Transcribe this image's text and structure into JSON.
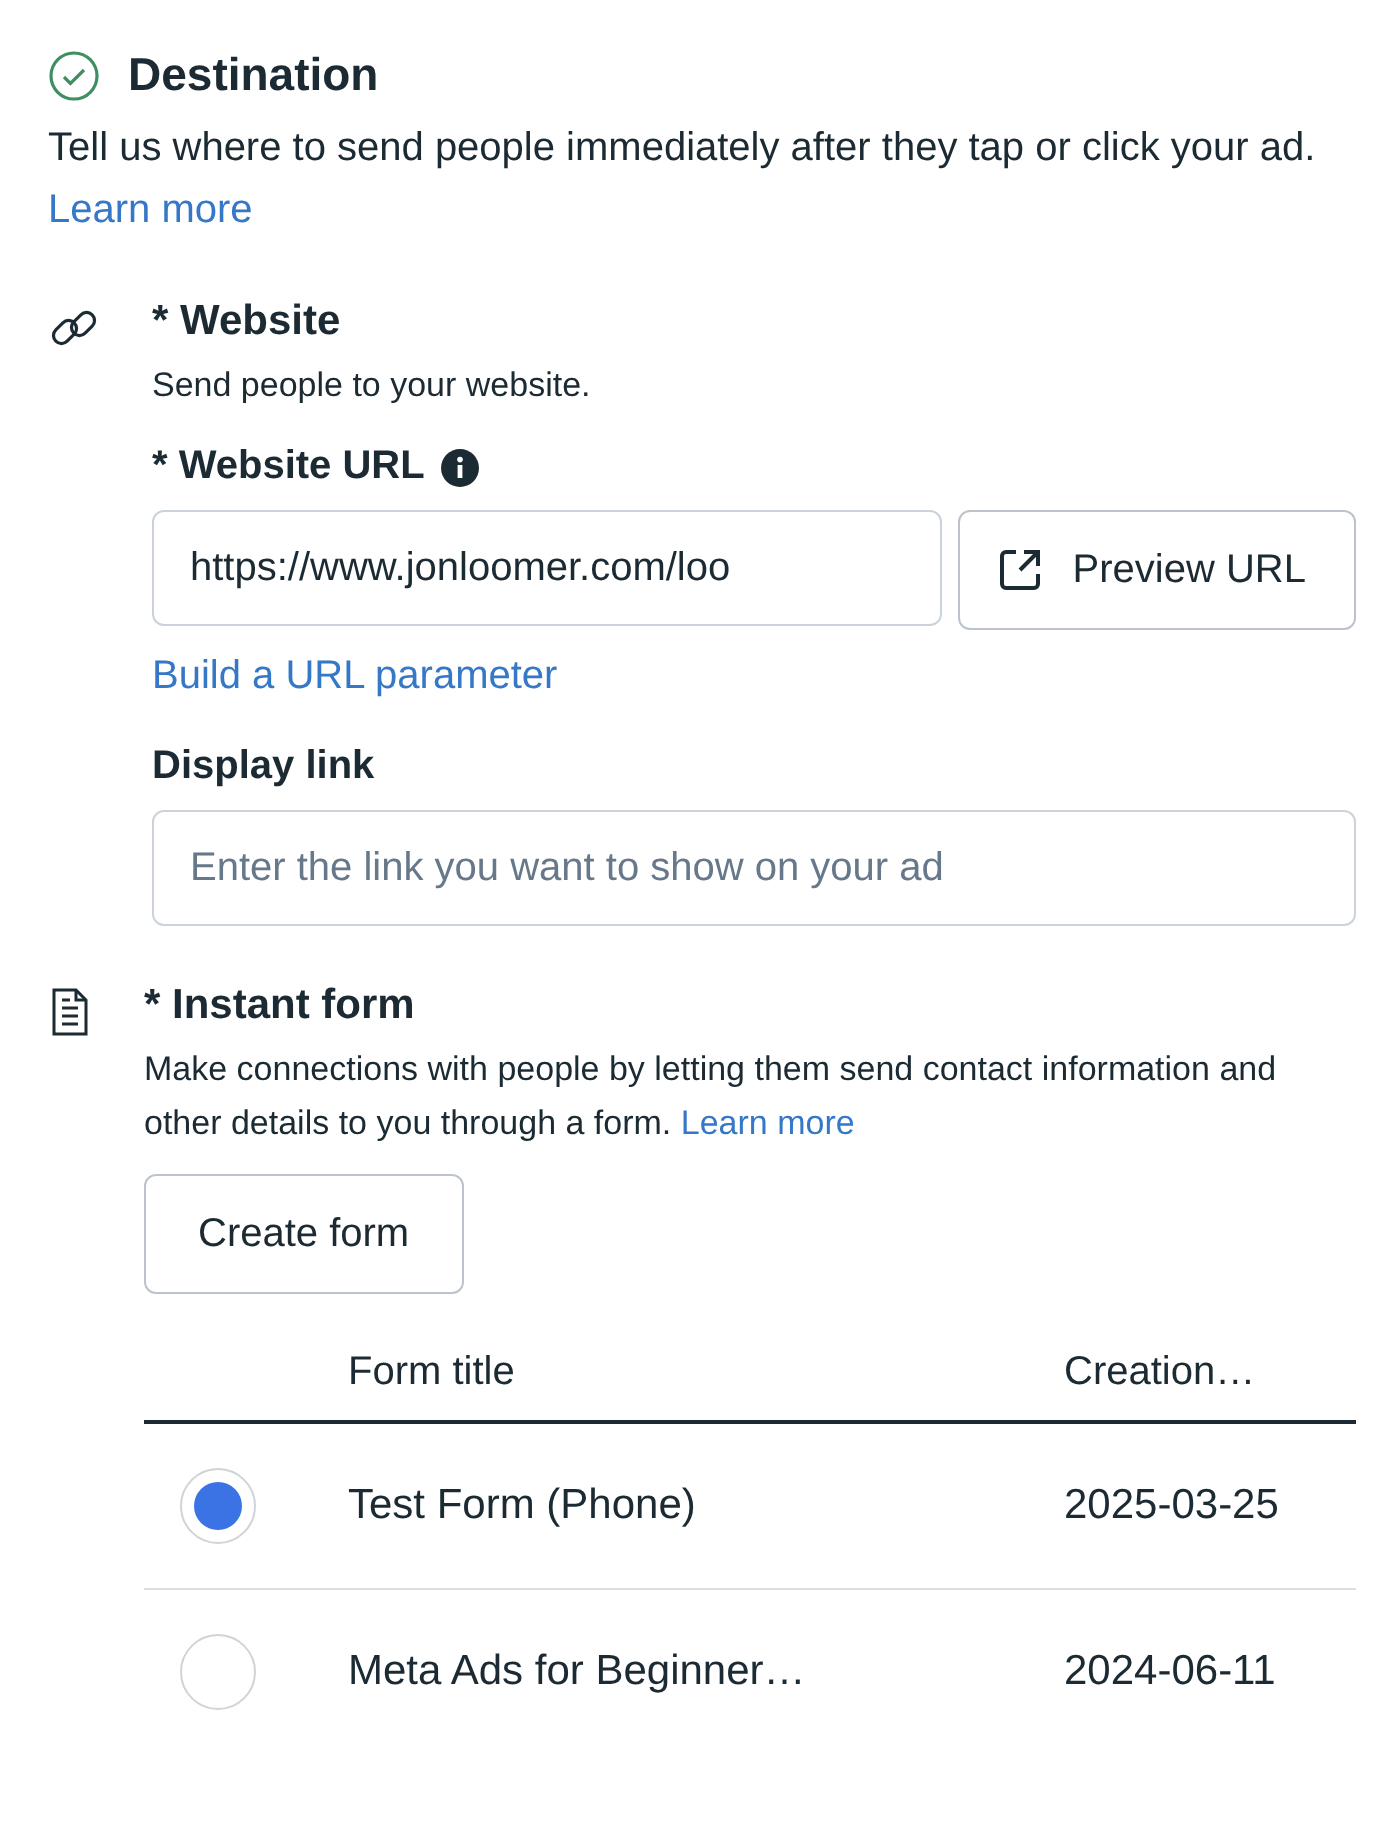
{
  "section": {
    "title": "Destination",
    "complete": true,
    "description": "Tell us where to send people immediately after they tap or click your ad.",
    "link": "Learn more"
  },
  "options": [
    {
      "kind": "website",
      "title": "* Website",
      "subtitle": "Send people to your website.",
      "url_label": "* Website URL",
      "url_value": "https://www.jonloomer.com/loo",
      "preview_button": "Preview URL",
      "param_link": "Build a URL parameter",
      "display_label": "Display link",
      "display_placeholder": "Enter the link you want to show on your ad"
    },
    {
      "kind": "form",
      "title": "* Instant form",
      "description": "Make connections with people by letting them send contact information and other details to you through a form.",
      "link": "Learn more",
      "button": "Create form",
      "table": {
        "columns": [
          "Form title",
          "Creation…"
        ],
        "rows": [
          {
            "selected": true,
            "title": "Test Form (Phone)",
            "date": "2025-03-25"
          },
          {
            "selected": false,
            "title": "Meta Ads for Beginner…",
            "date": "2024-06-11"
          }
        ]
      }
    }
  ]
}
